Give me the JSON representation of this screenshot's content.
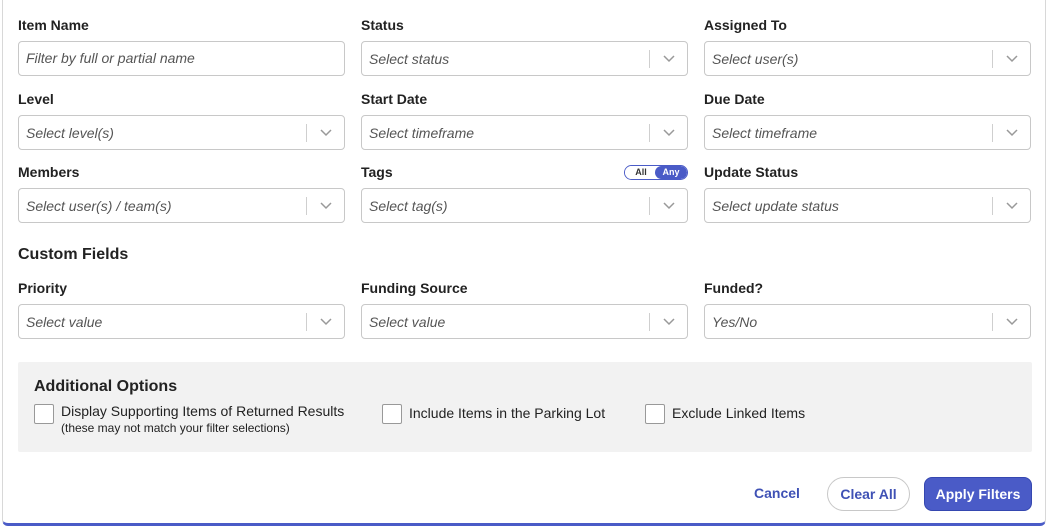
{
  "filters": {
    "item_name": {
      "label": "Item Name",
      "placeholder": "Filter by full or partial name"
    },
    "status": {
      "label": "Status",
      "placeholder": "Select status"
    },
    "assigned_to": {
      "label": "Assigned To",
      "placeholder": "Select user(s)"
    },
    "level": {
      "label": "Level",
      "placeholder": "Select level(s)"
    },
    "start_date": {
      "label": "Start Date",
      "placeholder": "Select timeframe"
    },
    "due_date": {
      "label": "Due Date",
      "placeholder": "Select timeframe"
    },
    "members": {
      "label": "Members",
      "placeholder": "Select user(s) / team(s)"
    },
    "tags": {
      "label": "Tags",
      "placeholder": "Select tag(s)",
      "toggle": {
        "all": "All",
        "any": "Any",
        "selected": "Any"
      }
    },
    "update_status": {
      "label": "Update Status",
      "placeholder": "Select update status"
    }
  },
  "custom_fields": {
    "title": "Custom Fields",
    "priority": {
      "label": "Priority",
      "placeholder": "Select value"
    },
    "funding_source": {
      "label": "Funding Source",
      "placeholder": "Select value"
    },
    "funded": {
      "label": "Funded?",
      "placeholder": "Yes/No"
    }
  },
  "additional_options": {
    "title": "Additional Options",
    "display_supporting": {
      "label": "Display Supporting Items of Returned Results",
      "sublabel": "(these may not match your filter selections)",
      "checked": false
    },
    "parking_lot": {
      "label": "Include Items in the Parking Lot",
      "checked": false
    },
    "exclude_linked": {
      "label": "Exclude Linked Items",
      "checked": false
    }
  },
  "actions": {
    "cancel": "Cancel",
    "clear_all": "Clear All",
    "apply": "Apply Filters"
  },
  "colors": {
    "accent": "#4a5bc7",
    "link": "#3f51b5",
    "options_bg": "#f2f2f2"
  }
}
